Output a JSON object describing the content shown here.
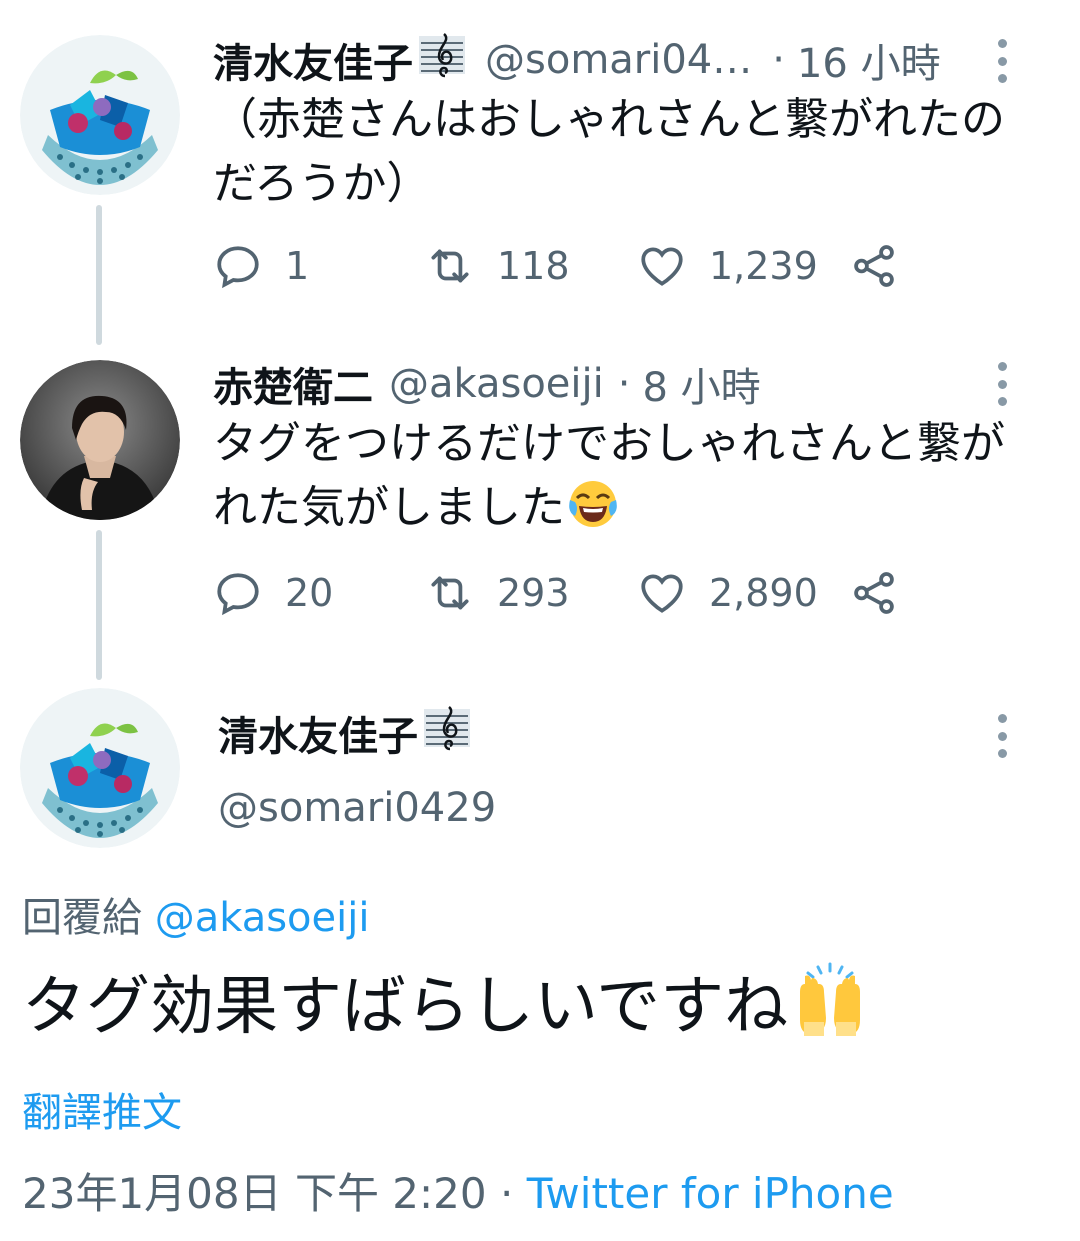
{
  "tweets": [
    {
      "name": "清水友佳子",
      "handle": "@somari04…",
      "dot": "·",
      "time": "16 小時",
      "text_line1": "（赤楚さんはおしゃれさんと繋がれたの",
      "text_line2": "だろうか）",
      "replies": "1",
      "retweets": "118",
      "likes": "1,239"
    },
    {
      "name": "赤楚衛二",
      "handle": "@akasoeiji",
      "dot": "·",
      "time": "8 小時",
      "text_line1": "タグをつけるだけでおしゃれさんと繋が",
      "text_line2": "れた気がしました",
      "replies": "20",
      "retweets": "293",
      "likes": "2,890"
    }
  ],
  "main": {
    "name": "清水友佳子",
    "handle": "@somari0429",
    "reply_prefix": "回覆給",
    "reply_to": "@akasoeiji",
    "text": "タグ効果すばらしいですね",
    "translate": "翻譯推文",
    "timestamp": "23年1月08日 下午 2:20",
    "dot": "·",
    "source": "Twitter for iPhone"
  },
  "colors": {
    "text": "#0f1419",
    "muted": "#536471",
    "link": "#1d9bf0",
    "thread_line": "#cfd9de"
  },
  "icons": [
    "reply-icon",
    "retweet-icon",
    "like-icon",
    "share-icon",
    "more-icon",
    "treble-clef-icon",
    "laughing-tears-emoji",
    "raised-hands-emoji"
  ]
}
